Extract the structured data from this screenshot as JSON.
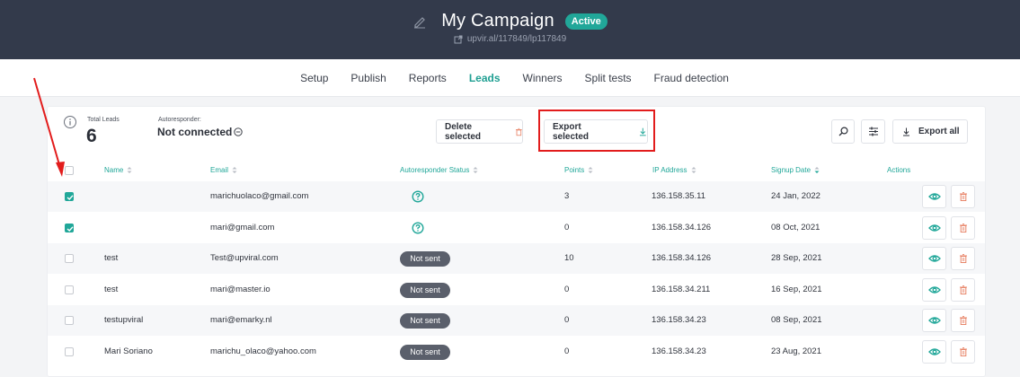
{
  "header": {
    "title": "My Campaign",
    "status_badge": "Active",
    "url": "upvir.al/117849/lp117849"
  },
  "tabs": [
    {
      "label": "Setup"
    },
    {
      "label": "Publish"
    },
    {
      "label": "Reports"
    },
    {
      "label": "Leads",
      "active": true
    },
    {
      "label": "Winners"
    },
    {
      "label": "Split tests"
    },
    {
      "label": "Fraud detection"
    }
  ],
  "summary": {
    "total_leads_label": "Total Leads",
    "total_leads_value": "6",
    "autoresponder_label": "Autoresponder:",
    "autoresponder_value": "Not connected"
  },
  "toolbar": {
    "delete_label": "Delete selected",
    "export_selected_label": "Export selected",
    "export_all_label": "Export all"
  },
  "table": {
    "columns": [
      "Name",
      "Email",
      "Autoresponder Status",
      "Points",
      "IP Address",
      "Signup Date",
      "Actions"
    ],
    "rows": [
      {
        "checked": true,
        "name": "",
        "email": "marichuolaco@gmail.com",
        "status": "",
        "points": "3",
        "ip": "136.158.35.11",
        "date": "24 Jan, 2022"
      },
      {
        "checked": true,
        "name": "",
        "email": "mari@gmail.com",
        "status": "",
        "points": "0",
        "ip": "136.158.34.126",
        "date": "08 Oct, 2021"
      },
      {
        "checked": false,
        "name": "test",
        "email": "Test@upviral.com",
        "status": "Not sent",
        "points": "10",
        "ip": "136.158.34.126",
        "date": "28 Sep, 2021"
      },
      {
        "checked": false,
        "name": "test",
        "email": "mari@master.io",
        "status": "Not sent",
        "points": "0",
        "ip": "136.158.34.211",
        "date": "16 Sep, 2021"
      },
      {
        "checked": false,
        "name": "testupviral",
        "email": "mari@emarky.nl",
        "status": "Not sent",
        "points": "0",
        "ip": "136.158.34.23",
        "date": "08 Sep, 2021"
      },
      {
        "checked": false,
        "name": "Mari Soriano",
        "email": "marichu_olaco@yahoo.com",
        "status": "Not sent",
        "points": "0",
        "ip": "136.158.34.23",
        "date": "23 Aug, 2021"
      }
    ]
  },
  "colors": {
    "header_bg": "#333a4b",
    "accent": "#21a799",
    "highlight": "#e21c1c",
    "delete_icon": "#e8866a",
    "pill_bg": "#5a5f6b"
  },
  "icons": [
    "edit-icon",
    "link-icon",
    "info-icon",
    "minus-circle-icon",
    "trash-icon",
    "download-icon",
    "search-icon",
    "filter-icon",
    "sort-icon",
    "question-icon",
    "eye-icon",
    "check-icon"
  ]
}
